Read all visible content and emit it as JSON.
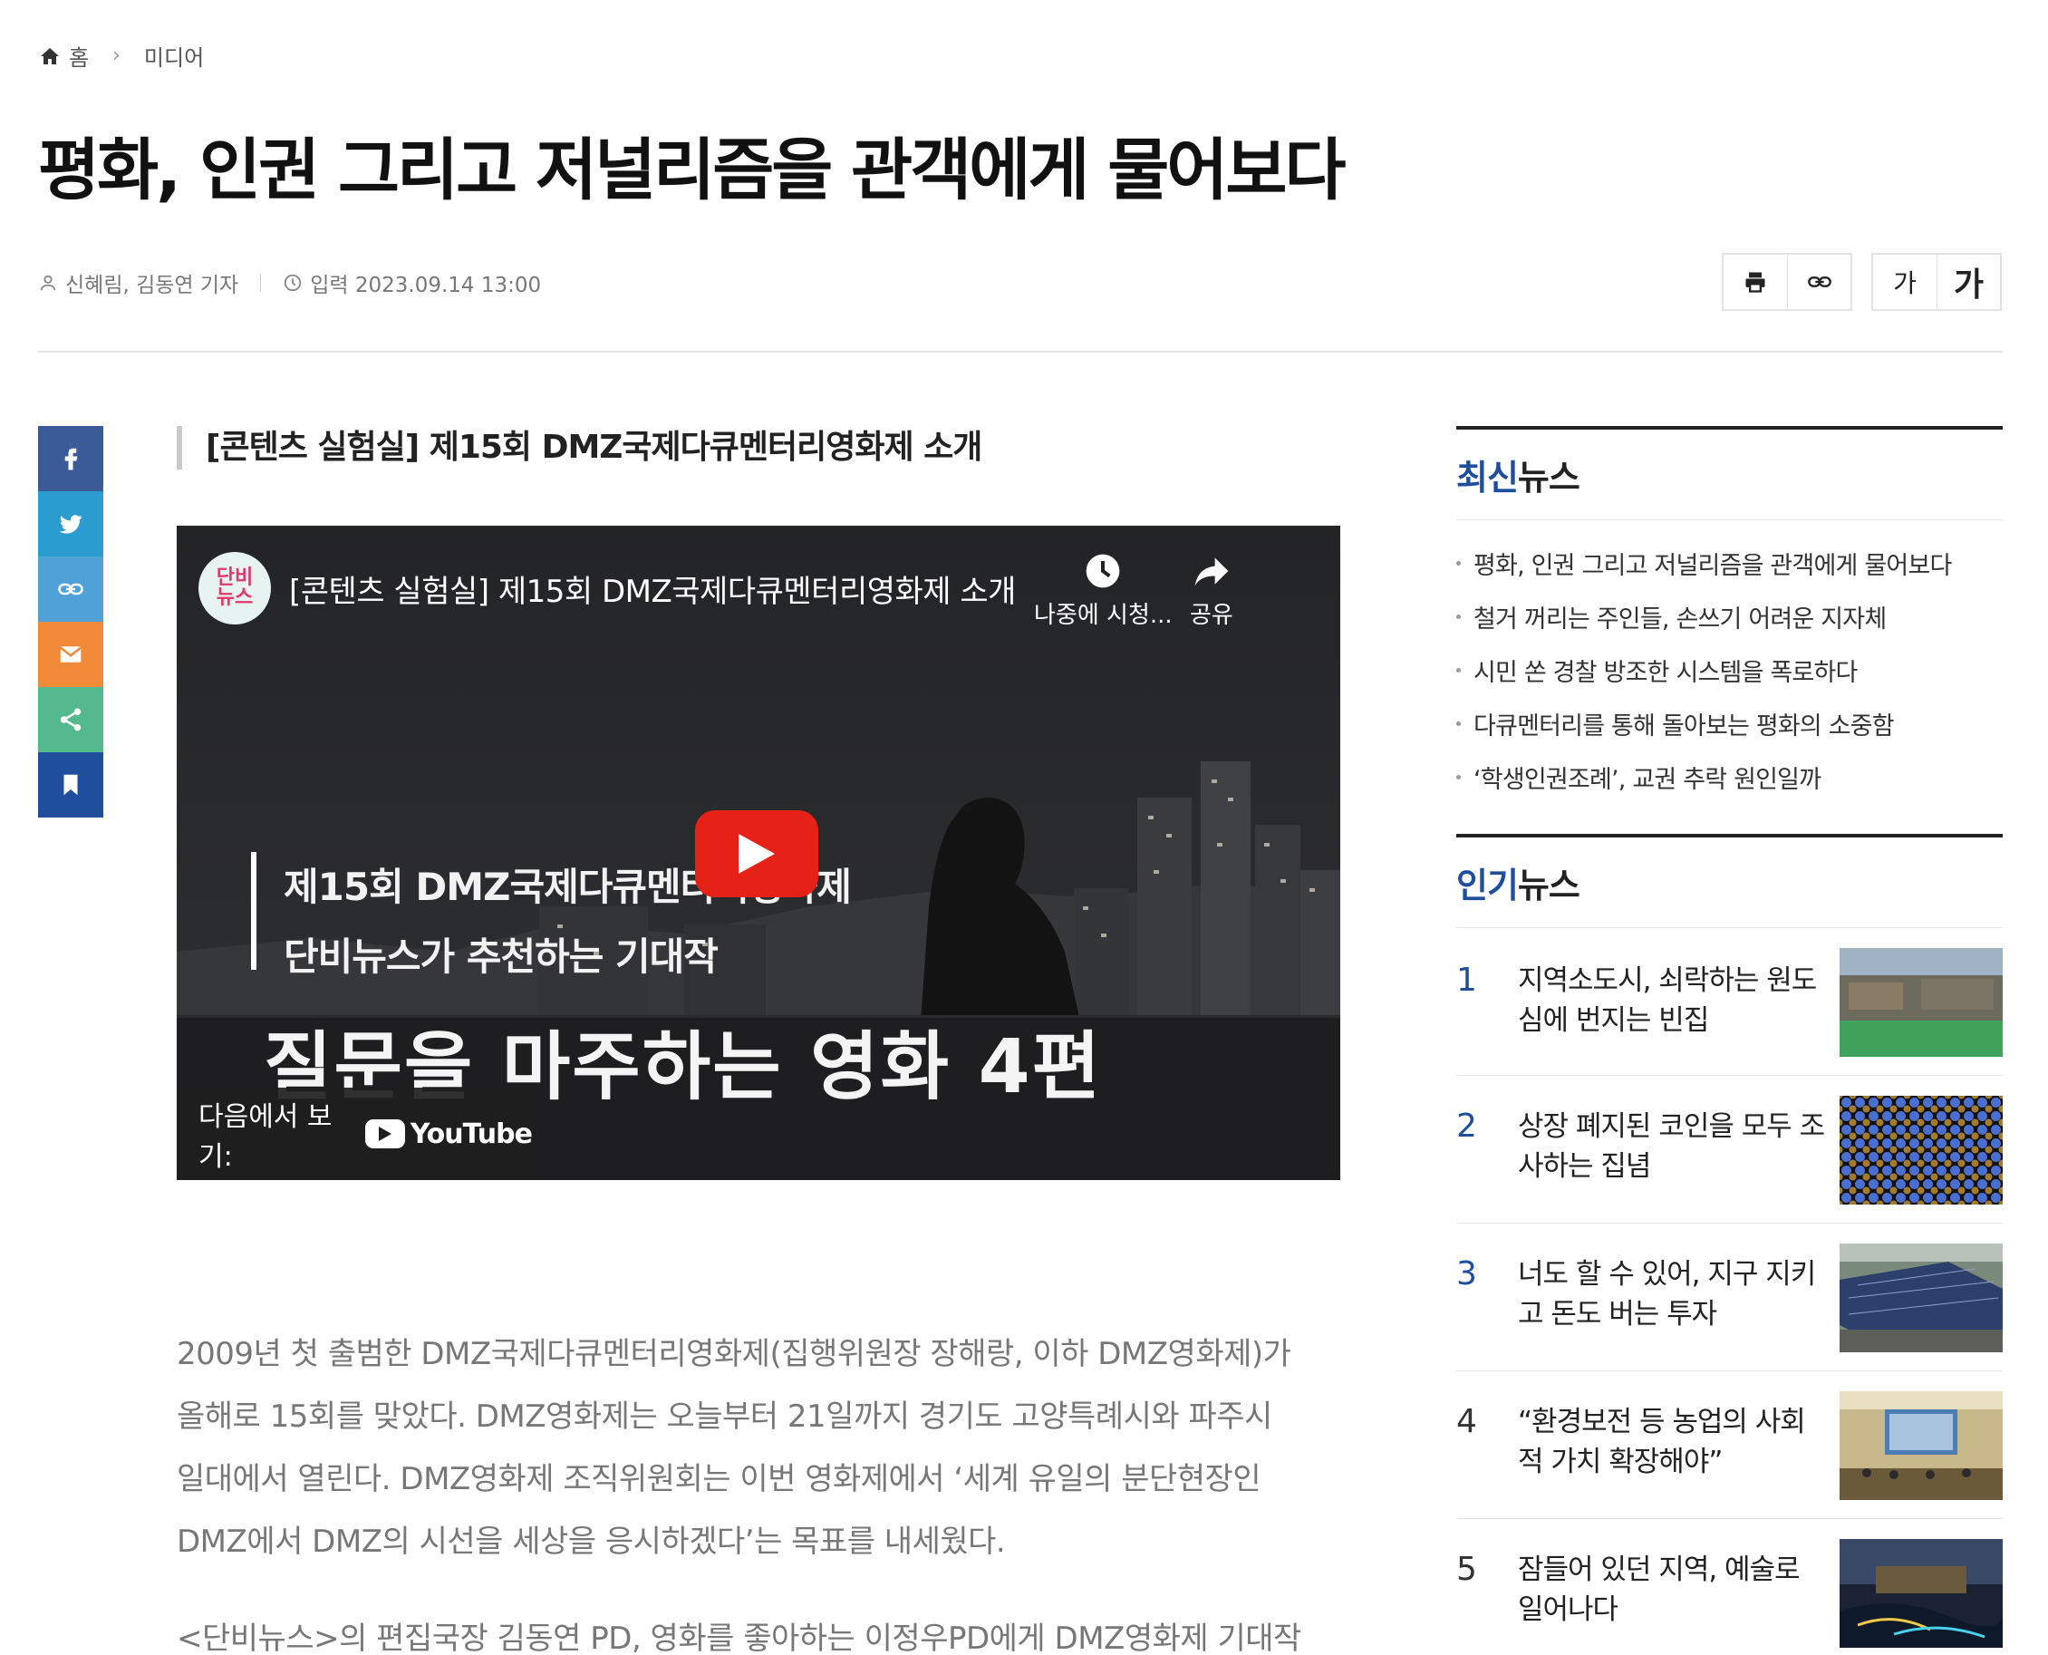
{
  "breadcrumb": {
    "home": "홈",
    "section": "미디어"
  },
  "article": {
    "title": "평화, 인권 그리고 저널리즘을 관객에게 물어보다",
    "byline": "신혜림, 김동연 기자",
    "published": "입력 2023.09.14 13:00",
    "subtitle": "[콘텐츠 실험실] 제15회 DMZ국제다큐멘터리영화제 소개",
    "paragraphs": [
      "2009년 첫 출범한 DMZ국제다큐멘터리영화제(집행위원장 장해랑, 이하 DMZ영화제)가",
      "올해로 15회를 맞았다. DMZ영화제는 오늘부터 21일까지 경기도 고양특례시와 파주시",
      "일대에서 열린다. DMZ영화제 조직위원회는 이번 영화제에서 ‘세계 유일의 분단현장인",
      "DMZ에서 DMZ의 시선을 세상을 응시하겠다’는 목표를 내세웠다."
    ],
    "paragraph2": "<단비뉴스>의 편집국장 김동연 PD, 영화를 좋아하는 이정우PD에게 DMZ영화제 기대작"
  },
  "tools": {
    "font_small": "가",
    "font_large": "가"
  },
  "video": {
    "channel_logo": "단비\n뉴스",
    "title": "[콘텐츠 실험실] 제15회 DMZ국제다큐멘터리영화제 소개",
    "watch_later": "나중에 시청...",
    "share": "공유",
    "caption_line1": "제15회 DMZ국제다큐멘터리영화제",
    "caption_line2": "단비뉴스가 추천하는 기대작",
    "caption_big": "질문을 마주하는 영화 4편",
    "watch_on": "다음에서 보기:",
    "youtube": "YouTube"
  },
  "latest": {
    "heading_accent": "최신",
    "heading_rest": "뉴스",
    "items": [
      "평화, 인권 그리고 저널리즘을 관객에게 물어보다",
      "철거 꺼리는 주인들, 손쓰기 어려운 지자체",
      "시민 쏜 경찰 방조한 시스템을 폭로하다",
      "다큐멘터리를 통해 돌아보는 평화의 소중함",
      "‘학생인권조례’, 교권 추락 원인일까"
    ]
  },
  "popular": {
    "heading_accent": "인기",
    "heading_rest": "뉴스",
    "items": [
      {
        "rank": "1",
        "title": "지역소도시, 쇠락하는 원도심에 번지는 빈집"
      },
      {
        "rank": "2",
        "title": "상장 폐지된 코인을 모두 조사하는 집념"
      },
      {
        "rank": "3",
        "title": "너도 할 수 있어, 지구 지키고 돈도 버는 투자"
      },
      {
        "rank": "4",
        "title": "“환경보전 등 농업의 사회적 가치 확장해야”"
      },
      {
        "rank": "5",
        "title": "잠들어 있던 지역, 예술로 일어나다"
      }
    ]
  },
  "colors": {
    "accent": "#1f4e9c",
    "youtube_red": "#e62117"
  }
}
